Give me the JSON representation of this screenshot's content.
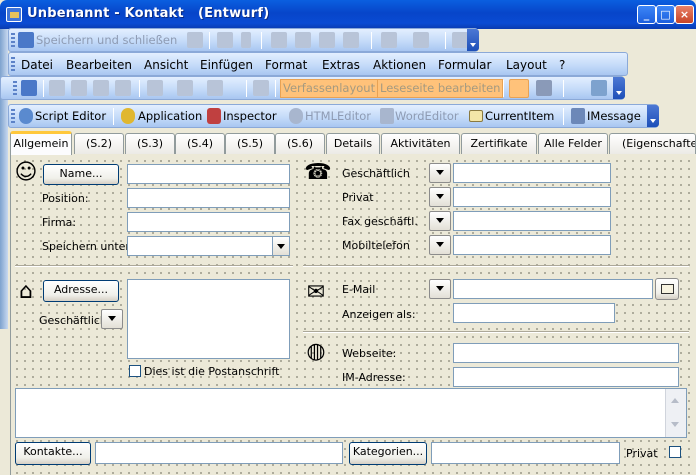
{
  "window": {
    "title": "Unbenannt - Kontakt   (Entwurf)",
    "minimize": "_",
    "maximize": "□",
    "close": "×"
  },
  "toolbar1": {
    "save_close": "Speichern und schließen",
    "save_close_underline": "c"
  },
  "menubar": {
    "items": [
      "Datei",
      "Bearbeiten",
      "Ansicht",
      "Einfügen",
      "Format",
      "Extras",
      "Aktionen",
      "Formular",
      "Layout",
      "?"
    ],
    "compose_layout": "Verfassenlayout",
    "read_page_edit": "Leseseite bearbeiten"
  },
  "toolbar3": {
    "script_editor": "Script Editor",
    "application": "Application",
    "inspector": "Inspector",
    "html_editor": "HTMLEditor",
    "word_editor": "WordEditor",
    "current_item": "CurrentItem",
    "imessage": "IMessage"
  },
  "tabs": [
    "Allgemein",
    "(S.2)",
    "(S.3)",
    "(S.4)",
    "(S.5)",
    "(S.6)",
    "Details",
    "Aktivitäten",
    "Zertifikate",
    "Alle Felder",
    "(Eigenschaften)"
  ],
  "form": {
    "name_button": "Name...",
    "position": "Position:",
    "firma": "Firma:",
    "speichern_unter": "Speichern unter:",
    "adresse_button": "Adresse...",
    "addr_type": "Geschäftlich",
    "postanschrift": "Dies ist die Postanschrift",
    "phones": [
      "Geschäftlich",
      "Privat",
      "Fax geschäftl.",
      "Mobiltelefon"
    ],
    "email": "E-Mail",
    "anzeigen_als": "Anzeigen als:",
    "webseite": "Webseite:",
    "im_adresse": "IM-Adresse:",
    "kontakte_button": "Kontakte...",
    "kategorien_button": "Kategorien...",
    "privat": "Privat"
  },
  "colors": {
    "titlebar": "#0A4BD3",
    "accent_tab": "#FFC83C",
    "dialog_bg": "#ECE9D8"
  }
}
